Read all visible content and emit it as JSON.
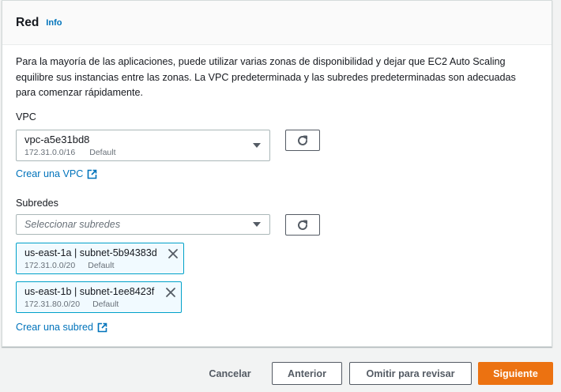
{
  "panel": {
    "title": "Red",
    "info_link": "Info",
    "description": "Para la mayoría de las aplicaciones, puede utilizar varias zonas de disponibilidad y dejar que EC2 Auto Scaling equilibre sus instancias entre las zonas. La VPC predeterminada y las subredes predeterminadas son adecuadas para comenzar rápidamente."
  },
  "vpc": {
    "label": "VPC",
    "selected_id": "vpc-a5e31bd8",
    "selected_cidr": "172.31.0.0/16",
    "selected_tag": "Default",
    "refresh_icon": "refresh-icon",
    "create_link": "Crear una VPC"
  },
  "subnets": {
    "label": "Subredes",
    "placeholder": "Seleccionar subredes",
    "refresh_icon": "refresh-icon",
    "selected": [
      {
        "name": "us-east-1a | subnet-5b94383d",
        "cidr": "172.31.0.0/20",
        "tag": "Default"
      },
      {
        "name": "us-east-1b | subnet-1ee8423f",
        "cidr": "172.31.80.0/20",
        "tag": "Default"
      }
    ],
    "create_link": "Crear una subred"
  },
  "footer": {
    "cancel": "Cancelar",
    "previous": "Anterior",
    "skip": "Omitir para revisar",
    "next": "Siguiente"
  },
  "colors": {
    "accent_link": "#0073bb",
    "primary_button": "#ec7211",
    "token_border": "#00a1c9",
    "token_bg": "#f1faff"
  }
}
